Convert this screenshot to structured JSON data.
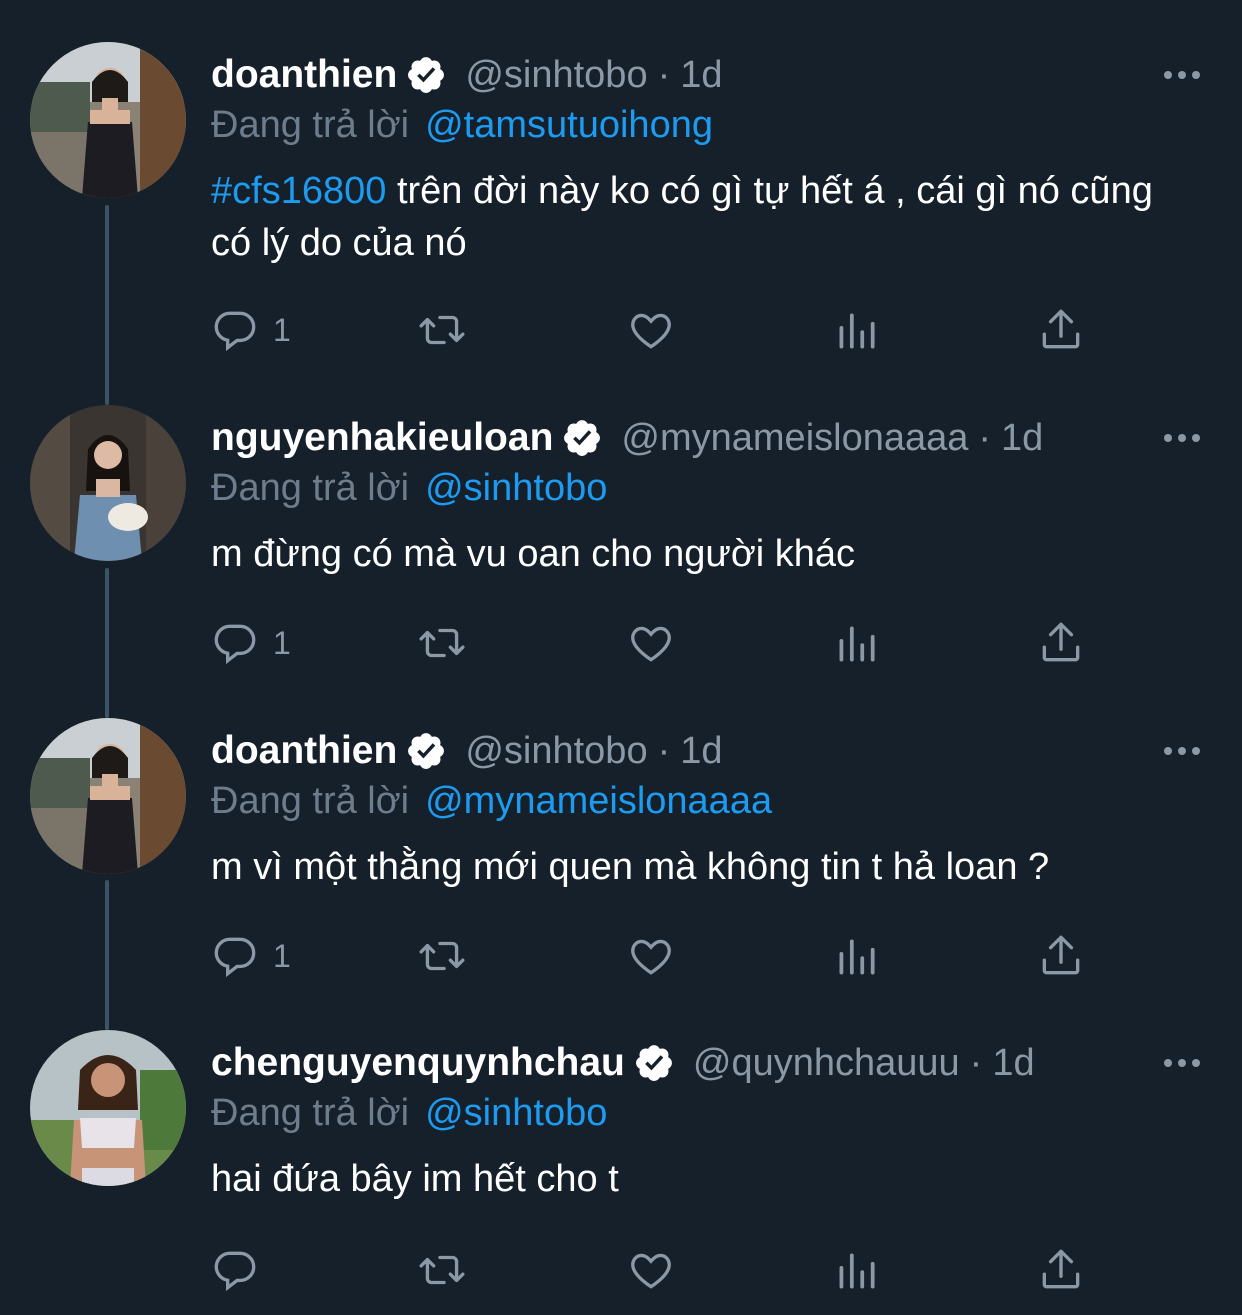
{
  "tweets": [
    {
      "name": "doanthien",
      "handle": "@sinhtobo",
      "time": "1d",
      "replying_label": "Đang trả lời",
      "replying_to": "@tamsutuoihong",
      "hashtag": "#cfs16800",
      "text": "trên đời này ko có gì tự hết á , cái gì nó cũng có lý do của nó",
      "reply_count": "1",
      "verified": true,
      "avatar": "avatar-woman-black-dress"
    },
    {
      "name": "nguyenhakieuloan",
      "handle": "@mynameislonaaaa",
      "time": "1d",
      "replying_label": "Đang trả lời",
      "replying_to": "@sinhtobo",
      "hashtag": "",
      "text": "m đừng có mà vu oan cho người khác",
      "reply_count": "1",
      "verified": true,
      "avatar": "avatar-woman-denim"
    },
    {
      "name": "doanthien",
      "handle": "@sinhtobo",
      "time": "1d",
      "replying_label": "Đang trả lời",
      "replying_to": "@mynameislonaaaa",
      "hashtag": "",
      "text": "m vì một thằng mới quen mà không tin t hả loan ?",
      "reply_count": "1",
      "verified": true,
      "avatar": "avatar-woman-black-dress"
    },
    {
      "name": "chenguyenquynhchau",
      "handle": "@quynhchauuu",
      "time": "1d",
      "replying_label": "Đang trả lời",
      "replying_to": "@sinhtobo",
      "hashtag": "",
      "text": "hai đứa bây im hết cho t",
      "reply_count": "",
      "verified": true,
      "avatar": "avatar-woman-sports-top"
    }
  ],
  "separator": "·",
  "colors": {
    "background": "#15202b",
    "accent": "#1d9bf0",
    "muted": "#8b98a5",
    "thread_line": "#3d5466"
  }
}
